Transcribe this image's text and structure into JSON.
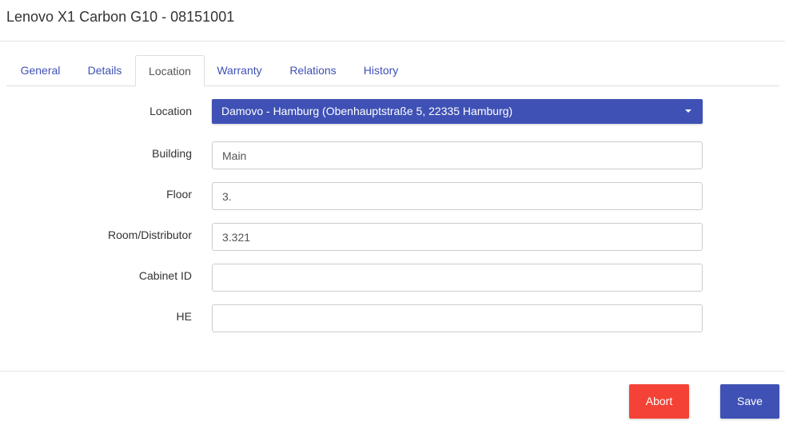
{
  "header": {
    "title": "Lenovo X1 Carbon G10 - 08151001"
  },
  "tabs": [
    {
      "label": "General",
      "active": false
    },
    {
      "label": "Details",
      "active": false
    },
    {
      "label": "Location",
      "active": true
    },
    {
      "label": "Warranty",
      "active": false
    },
    {
      "label": "Relations",
      "active": false
    },
    {
      "label": "History",
      "active": false
    }
  ],
  "form": {
    "location": {
      "label": "Location",
      "value": "Damovo - Hamburg (Obenhauptstraße 5, 22335 Hamburg)"
    },
    "building": {
      "label": "Building",
      "value": "Main",
      "placeholder": ""
    },
    "floor": {
      "label": "Floor",
      "value": "3.",
      "placeholder": ""
    },
    "room": {
      "label": "Room/Distributor",
      "value": "3.321",
      "placeholder": ""
    },
    "cabinet": {
      "label": "Cabinet ID",
      "value": "",
      "placeholder": ""
    },
    "he": {
      "label": "HE",
      "value": "",
      "placeholder": ""
    }
  },
  "footer": {
    "abort_label": "Abort",
    "save_label": "Save"
  },
  "colors": {
    "primary": "#3f51b5",
    "danger": "#f44336",
    "tab_link": "#3f51b5"
  }
}
